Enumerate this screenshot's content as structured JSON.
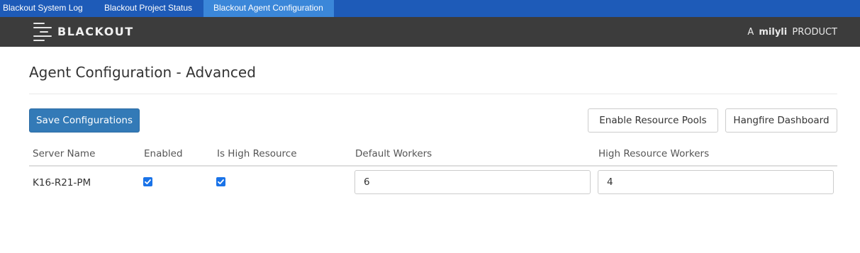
{
  "tabs": [
    {
      "label": "Blackout System Log",
      "active": false
    },
    {
      "label": "Blackout Project Status",
      "active": false
    },
    {
      "label": "Blackout Agent Configuration",
      "active": true
    }
  ],
  "brand": {
    "logo_text": "BLACKOUT",
    "product_prefix": "A",
    "product_brand": "milyli",
    "product_suffix": "PRODUCT"
  },
  "page": {
    "title": "Agent Configuration - Advanced"
  },
  "buttons": {
    "save": "Save Configurations",
    "enable_pools": "Enable Resource Pools",
    "hangfire": "Hangfire Dashboard"
  },
  "table": {
    "headers": {
      "server_name": "Server Name",
      "enabled": "Enabled",
      "is_high_resource": "Is High Resource",
      "default_workers": "Default Workers",
      "high_resource_workers": "High Resource Workers"
    },
    "rows": [
      {
        "server_name": "K16-R21-PM",
        "enabled": true,
        "is_high_resource": true,
        "default_workers": "6",
        "high_resource_workers": "4"
      }
    ]
  },
  "colors": {
    "tabbar": "#1e5bb8",
    "active_tab": "#3b87d9",
    "header": "#3c3c3c",
    "primary_button": "#337ab7",
    "checkbox": "#1a73e8"
  }
}
